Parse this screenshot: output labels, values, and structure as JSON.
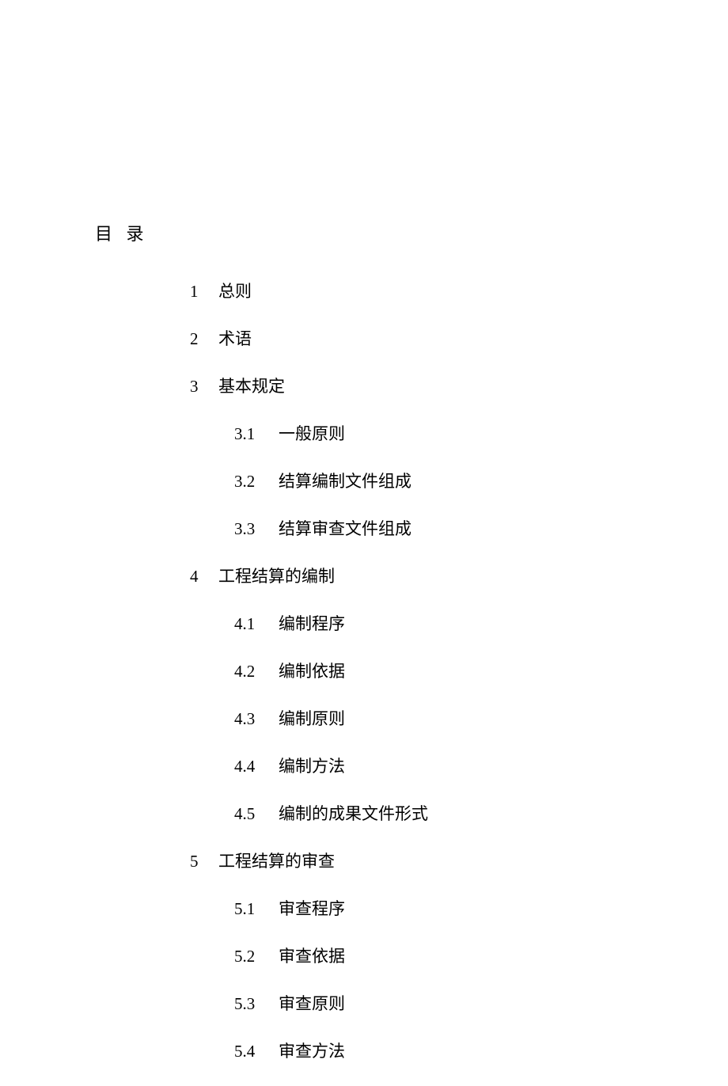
{
  "page_title": "目 录",
  "toc": [
    {
      "num": "1",
      "title": "总则",
      "level": 1
    },
    {
      "num": "2",
      "title": "术语",
      "level": 1
    },
    {
      "num": "3",
      "title": "基本规定",
      "level": 1
    },
    {
      "num": "3.1",
      "title": "一般原则",
      "level": 2
    },
    {
      "num": "3.2",
      "title": "结算编制文件组成",
      "level": 2
    },
    {
      "num": "3.3",
      "title": "结算审查文件组成",
      "level": 2
    },
    {
      "num": "4",
      "title": "工程结算的编制",
      "level": 1
    },
    {
      "num": "4.1",
      "title": "编制程序",
      "level": 2
    },
    {
      "num": "4.2",
      "title": "编制依据",
      "level": 2
    },
    {
      "num": "4.3",
      "title": "编制原则",
      "level": 2
    },
    {
      "num": "4.4",
      "title": "编制方法",
      "level": 2
    },
    {
      "num": "4.5",
      "title": "编制的成果文件形式",
      "level": 2
    },
    {
      "num": "5",
      "title": "工程结算的审查",
      "level": 1
    },
    {
      "num": "5.1",
      "title": "审查程序",
      "level": 2
    },
    {
      "num": "5.2",
      "title": "审查依据",
      "level": 2
    },
    {
      "num": "5.3",
      "title": "审查原则",
      "level": 2
    },
    {
      "num": "5.4",
      "title": "审查方法",
      "level": 2
    }
  ]
}
